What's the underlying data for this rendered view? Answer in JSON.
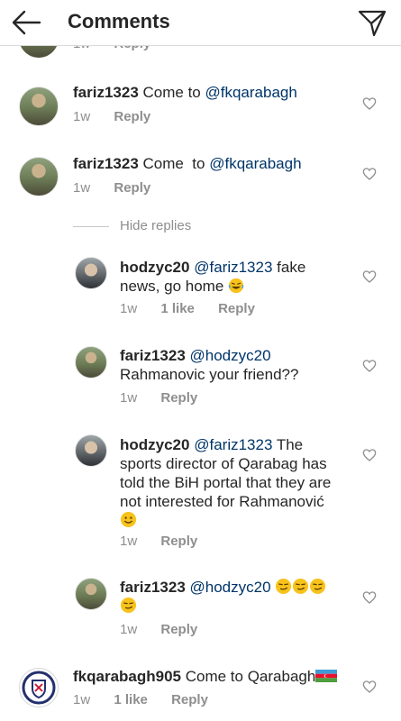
{
  "header": {
    "title": "Comments",
    "back_icon": "back-arrow-icon",
    "send_icon": "paper-plane-icon"
  },
  "top_partial": {
    "reply_label": "Reply",
    "time": "1w"
  },
  "comments": [
    {
      "user": "fariz1323",
      "body": "Come to ",
      "mention": "@fkqarabagh",
      "time": "1w",
      "reply_label": "Reply"
    },
    {
      "user": "fariz1323",
      "body": "Come  to ",
      "mention": "@fkqarabagh",
      "time": "1w",
      "reply_label": "Reply"
    }
  ],
  "hide_replies_label": "Hide replies",
  "replies": [
    {
      "user": "hodzyc20",
      "mention": "@fariz1323",
      "line1_after_mention": " fake",
      "line2": "news, go home",
      "emoji": "laugh-emoji",
      "time": "1w",
      "likes": "1 like",
      "reply_label": "Reply"
    },
    {
      "user": "fariz1323",
      "mention": "@hodzyc20",
      "line2": "Rahmanovic your friend??",
      "time": "1w",
      "reply_label": "Reply"
    },
    {
      "user": "hodzyc20",
      "mention": "@fariz1323",
      "line1_after_mention": " The",
      "line2": "sports director of Qarabag has",
      "line3": "told the BiH portal that they are",
      "line4": "not interested for Rahmanović",
      "emoji": "smile-emoji",
      "time": "1w",
      "reply_label": "Reply"
    },
    {
      "user": "fariz1323",
      "mention": "@hodzyc20",
      "emoji": "smirk-emoji",
      "time": "1w",
      "reply_label": "Reply"
    }
  ],
  "last_comment": {
    "user": "fkqarabagh905",
    "body": "Come to Qarabagh",
    "emoji": "azerbaijan-flag",
    "time": "1w",
    "likes": "1 like",
    "reply_label": "Reply"
  },
  "colors": {
    "mention": "#003569",
    "muted": "#8e8e8e",
    "text": "#262626",
    "emoji": "#f7c21b"
  }
}
